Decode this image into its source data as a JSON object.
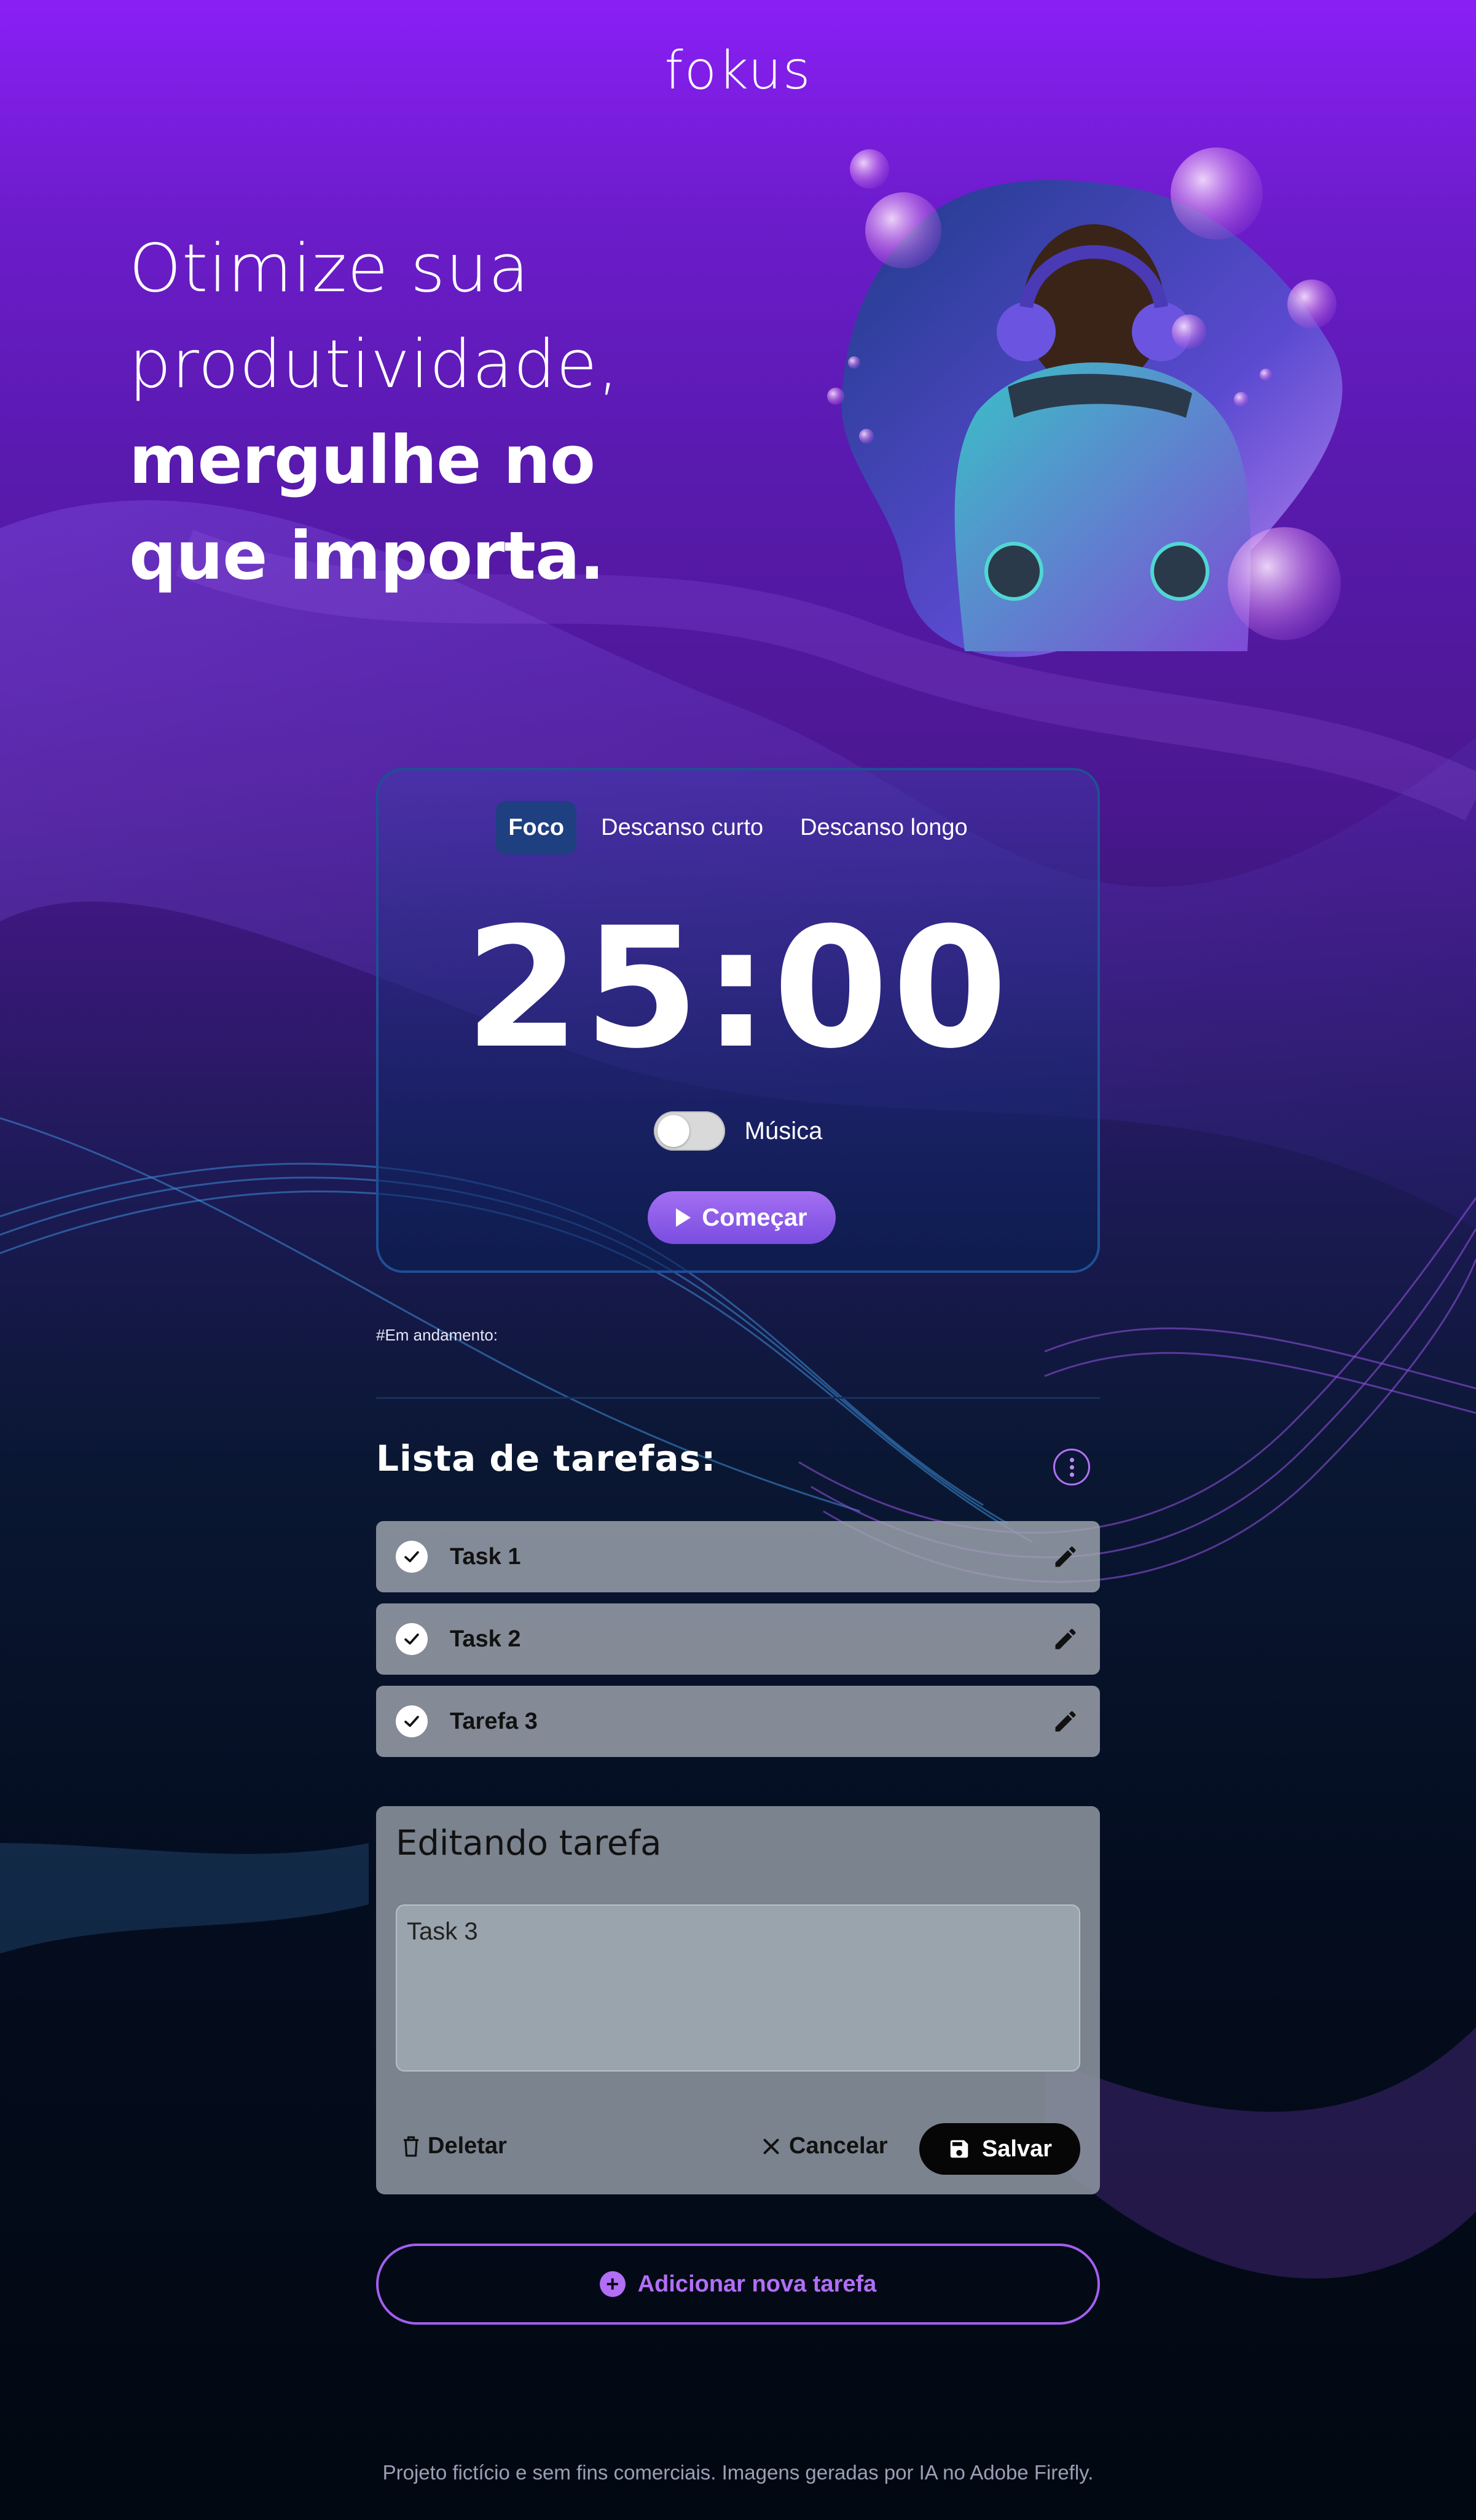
{
  "brand": {
    "logo_text": "fokus"
  },
  "hero": {
    "line1": "Otimize sua",
    "line2": "produtividade,",
    "line3": "mergulhe no",
    "line4": "que importa."
  },
  "timer": {
    "tabs": [
      {
        "label": "Foco",
        "active": true
      },
      {
        "label": "Descanso curto",
        "active": false
      },
      {
        "label": "Descanso longo",
        "active": false
      }
    ],
    "time": "25:00",
    "music_label": "Música",
    "music_on": false,
    "start_label": "Começar"
  },
  "in_progress_label": "#Em andamento:",
  "tasks": {
    "title": "Lista de tarefas:",
    "items": [
      {
        "label": "Task 1",
        "completed": true
      },
      {
        "label": "Task 2",
        "completed": true
      },
      {
        "label": "Tarefa 3",
        "completed": true
      }
    ]
  },
  "edit_form": {
    "title": "Editando tarefa",
    "textarea_value": "Task 3",
    "delete_label": "Deletar",
    "cancel_label": "Cancelar",
    "save_label": "Salvar"
  },
  "add_task_label": "Adicionar nova tarefa",
  "footer_text": "Projeto fictício e sem fins comerciais. Imagens geradas por IA no Adobe Firefly.",
  "colors": {
    "accent_purple": "#b26ef7",
    "active_tab": "#1e3f80",
    "card_border": "#1f4f96"
  }
}
